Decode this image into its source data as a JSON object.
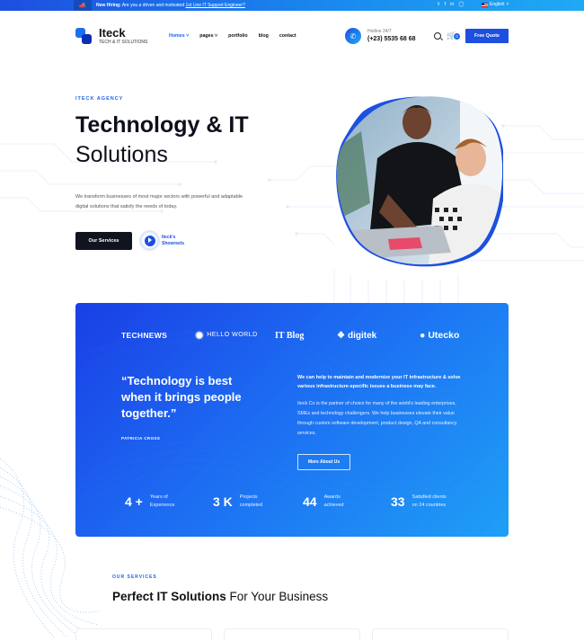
{
  "topbar": {
    "hiring_label": "New Hiring:",
    "hiring_text": "Are you a driven and motivated",
    "hiring_link": "1st Line IT Support Engineer?",
    "social": [
      "twitter",
      "facebook",
      "linkedin",
      "instagram"
    ],
    "language": "English"
  },
  "header": {
    "logo_name": "Iteck",
    "logo_sub": "TECH & IT SOLUTIONS",
    "nav": [
      "Homes",
      "pages",
      "portfolio",
      "blog",
      "contact"
    ],
    "hotline_label": "Hotline 24/7",
    "hotline_number": "(+23) 5535 68 68",
    "cart_count": "0",
    "quote_button": "Free Quote"
  },
  "hero": {
    "eyebrow": "ITECK AGENCY",
    "title_bold": "Technology & IT",
    "title_light": "Solutions",
    "description": "We transform businesses of most major sectors with powerful and adaptable digital solutions that satisfy the needs of today.",
    "primary_button": "Our Services",
    "showreel_line1": "Iteck's",
    "showreel_line2": "Showreels"
  },
  "partners": [
    "TECHNEWS",
    "HELLO WORLD",
    "IT Blog",
    "digitek",
    "Utecko"
  ],
  "about": {
    "quote": "“Technology is best when it brings people together.”",
    "author": "PATRICIA CROSS",
    "lead": "We can help to maintain and modernize your IT infrastructure & solve various infrastructure-specific issues a business may face.",
    "body": "Iteck Co is the partner of choice for many of the world's leading enterprises, SMEs and technology challengers. We help businesses elevate their value through custom software development, product design, QA and consultancy services.",
    "button": "More About Us"
  },
  "stats": [
    {
      "num": "4 +",
      "l1": "Years of",
      "l2": "Experience"
    },
    {
      "num": "3 K",
      "l1": "Projects",
      "l2": "completed"
    },
    {
      "num": "44",
      "l1": "Awards",
      "l2": "achieved"
    },
    {
      "num": "33",
      "l1": "Satisfied clients",
      "l2": "on 24 countries"
    }
  ],
  "services": {
    "eyebrow": "OUR SERVICES",
    "title_bold": "Perfect IT Solutions",
    "title_rest": " For Your Business"
  },
  "colors": {
    "accent": "#1d63e8",
    "dark": "#10141f",
    "gradient_start": "#1a3fe5",
    "gradient_end": "#1e9ff6"
  }
}
